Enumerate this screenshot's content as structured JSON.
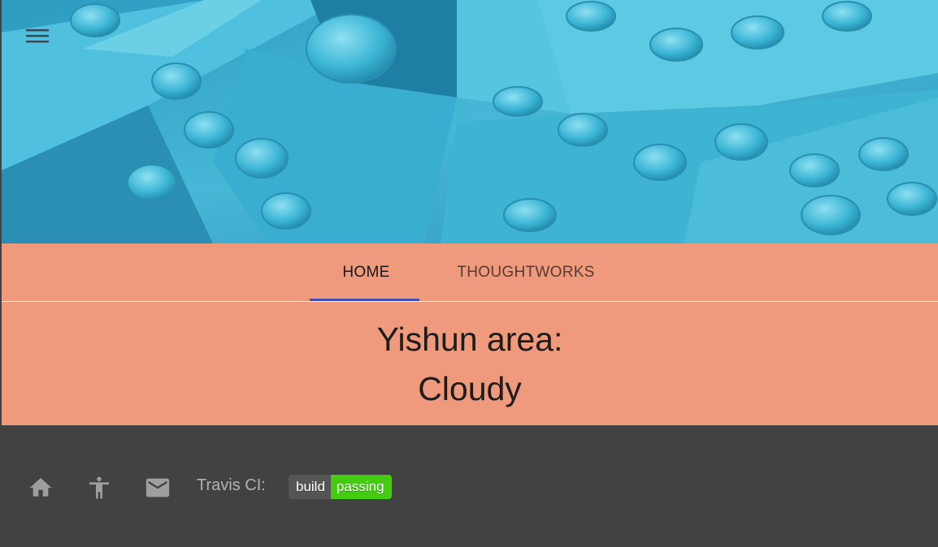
{
  "header": {
    "menu_icon": "hamburger-menu-icon",
    "hero_image": "blue-lego-bricks"
  },
  "nav": {
    "tabs": [
      {
        "label": "HOME",
        "active": true
      },
      {
        "label": "THOUGHTWORKS",
        "active": false
      }
    ]
  },
  "weather": {
    "area": "Yishun area:",
    "condition": "Cloudy"
  },
  "footer": {
    "icons": [
      "home-icon",
      "accessibility-icon",
      "mail-icon"
    ],
    "travis_label": "Travis CI:",
    "badge": {
      "left": "build",
      "right": "passing"
    }
  },
  "colors": {
    "accent_bg": "#ef9a7c",
    "footer_bg": "#424242",
    "tab_indicator": "#3f51b5",
    "badge_pass": "#44cc11"
  }
}
